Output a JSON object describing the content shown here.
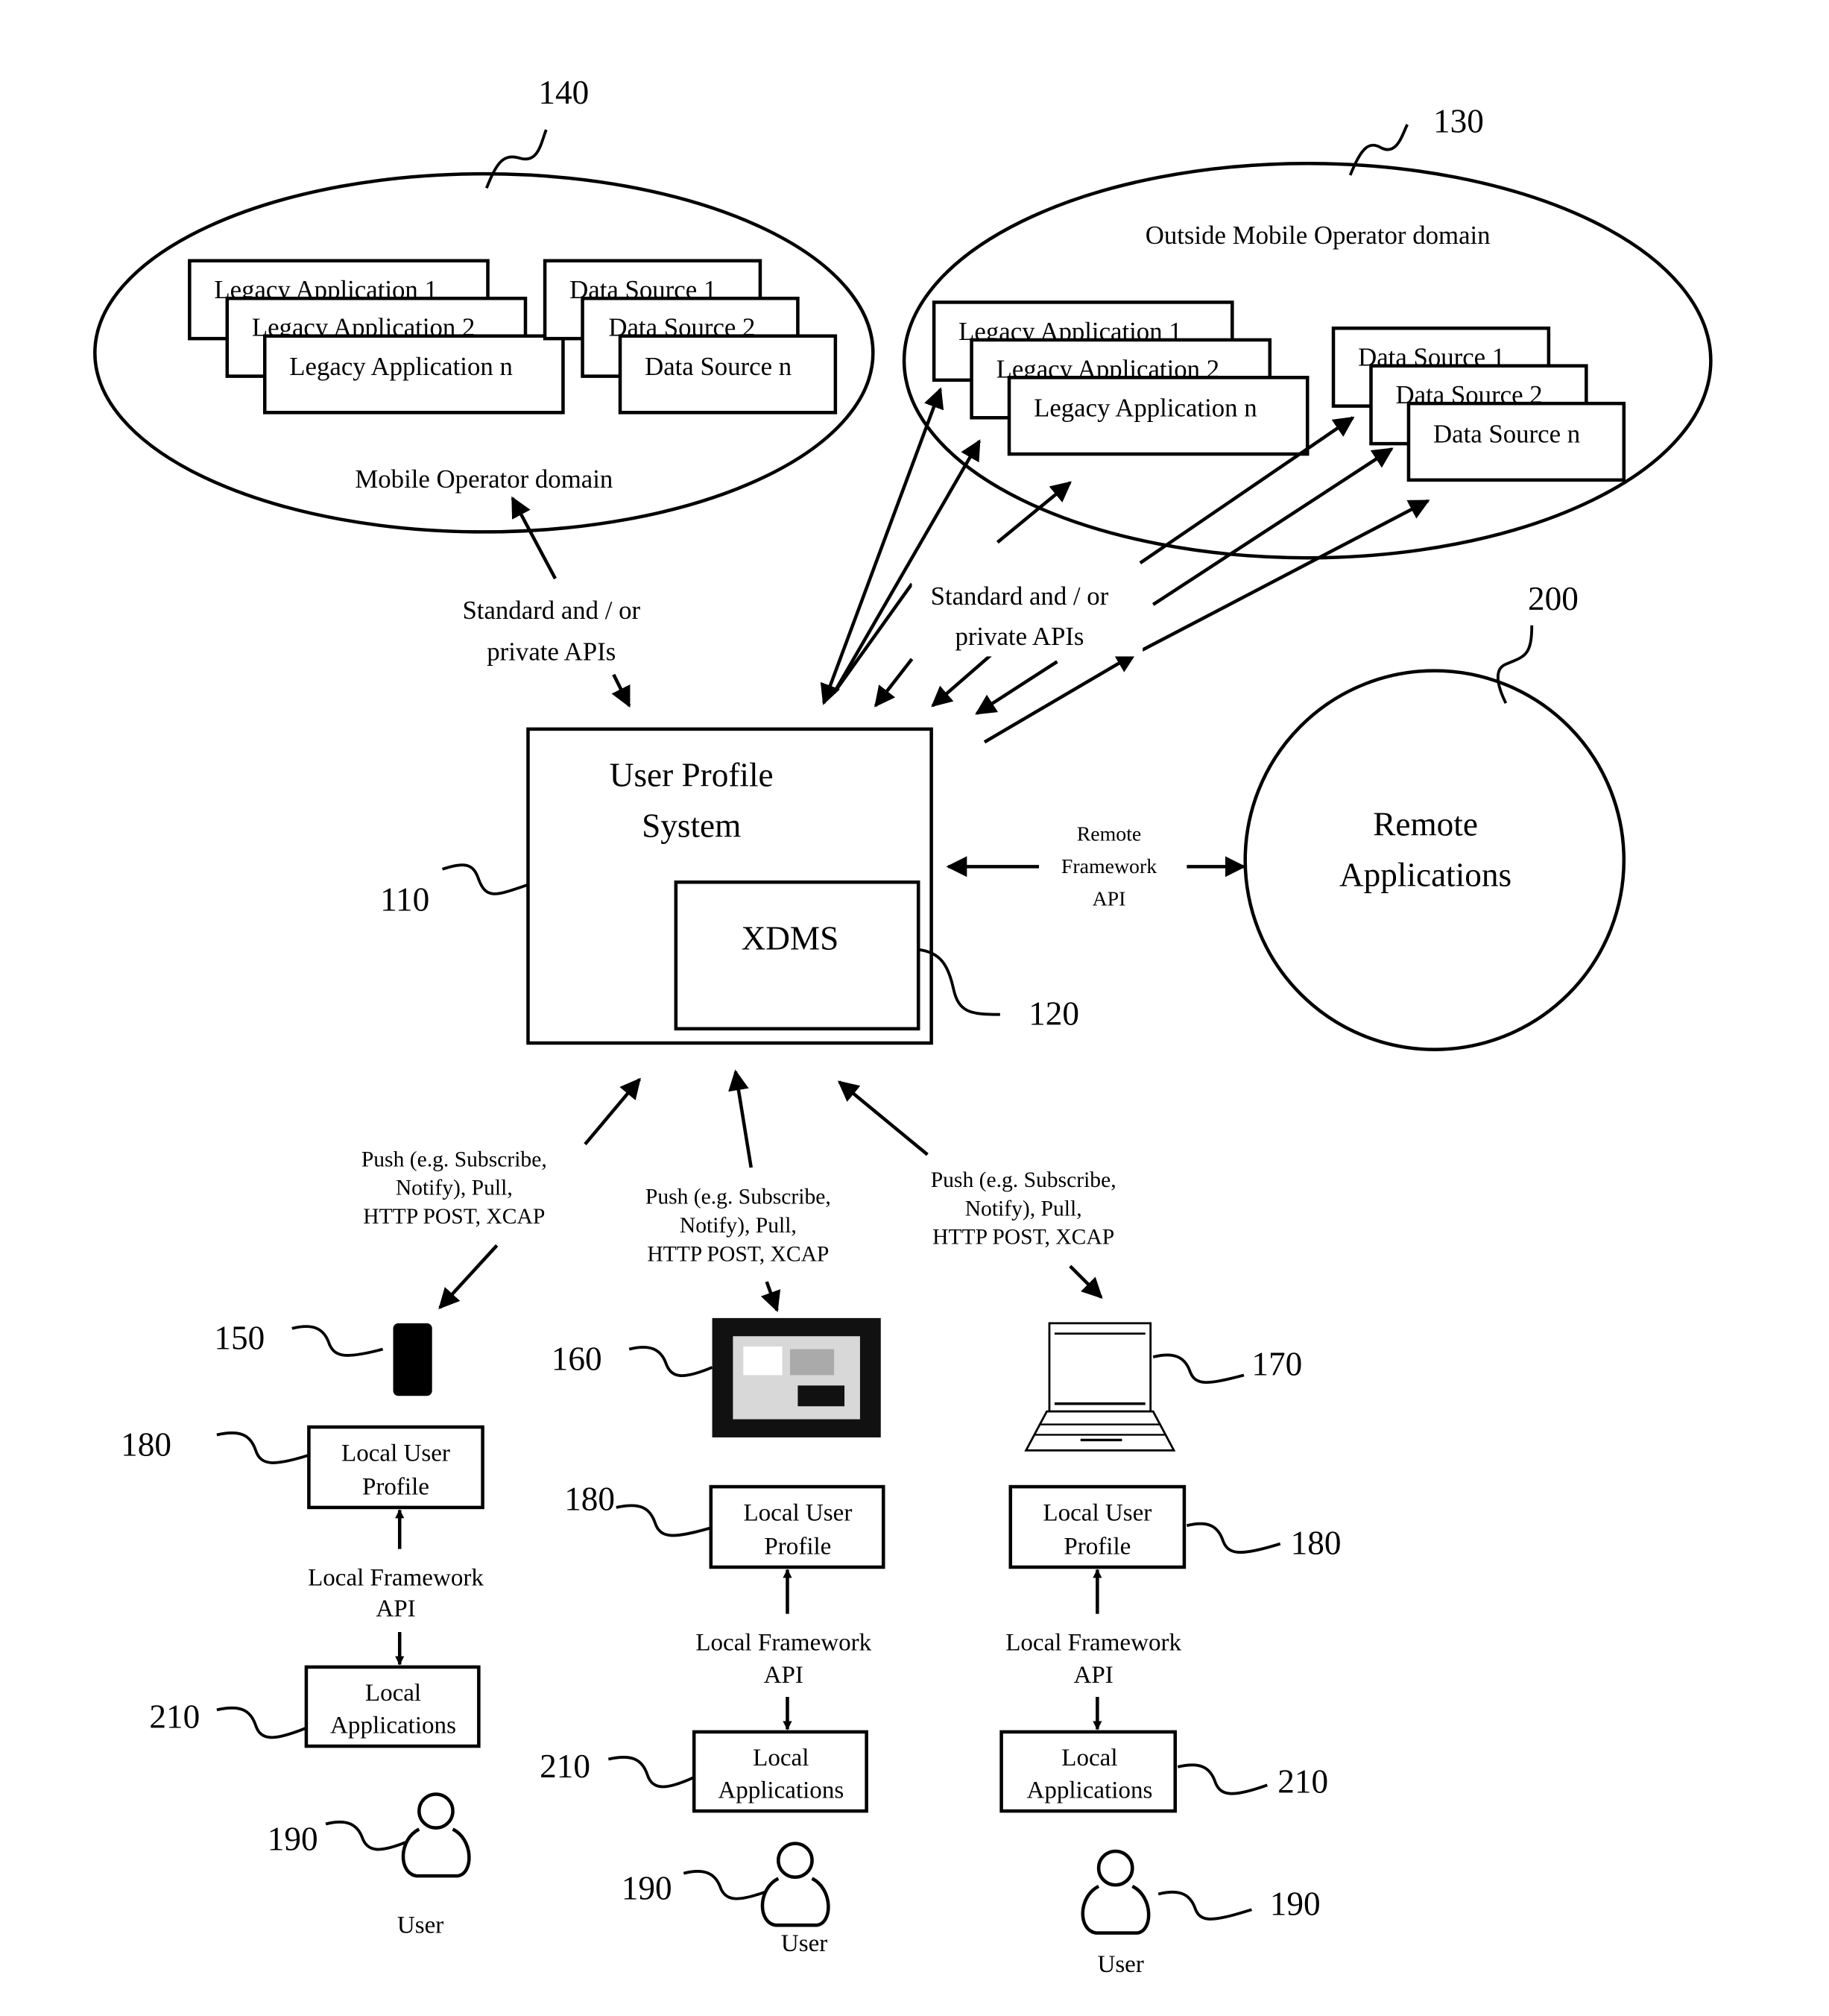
{
  "figure": {
    "mobile_operator_domain": {
      "ref": "140",
      "label": "Mobile Operator domain",
      "legacy_apps": [
        "Legacy Application 1",
        "Legacy Application 2",
        "Legacy Application n"
      ],
      "data_sources": [
        "Data Source 1",
        "Data Source 2",
        "Data Source n"
      ]
    },
    "outside_domain": {
      "ref": "130",
      "label": "Outside Mobile Operator domain",
      "legacy_apps": [
        "Legacy Application 1",
        "Legacy Application 2",
        "Legacy Application n"
      ],
      "data_sources": [
        "Data Source 1",
        "Data Source 2",
        "Data Source n"
      ]
    },
    "api_label_left": [
      "Standard and / or",
      "private APIs"
    ],
    "api_label_right": [
      "Standard and / or",
      "private APIs"
    ],
    "user_profile_system": {
      "ref": "110",
      "title_lines": [
        "User Profile",
        "System"
      ],
      "xdms": {
        "ref": "120",
        "label": "XDMS"
      }
    },
    "remote_framework_api": [
      "Remote",
      "Framework",
      "API"
    ],
    "remote_applications": {
      "ref": "200",
      "label_lines": [
        "Remote",
        "Applications"
      ]
    },
    "protocol_label": [
      "Push (e.g. Subscribe,",
      "Notify), Pull,",
      "HTTP POST, XCAP"
    ],
    "devices": [
      {
        "ref": "150",
        "type": "mobile-phone"
      },
      {
        "ref": "160",
        "type": "tablet"
      },
      {
        "ref": "170",
        "type": "laptop"
      }
    ],
    "local_user_profile": {
      "ref": "180",
      "label_lines": [
        "Local User",
        "Profile"
      ]
    },
    "local_framework_api": [
      "Local Framework",
      "API"
    ],
    "local_applications": {
      "ref": "210",
      "label_lines": [
        "Local",
        "Applications"
      ]
    },
    "user": {
      "ref": "190",
      "label": "User"
    }
  }
}
